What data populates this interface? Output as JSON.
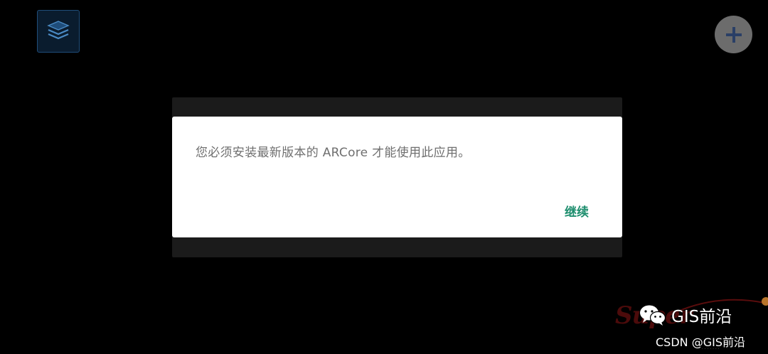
{
  "toolbar": {
    "layers_icon": "layers-icon",
    "add_icon": "plus-icon"
  },
  "dialog": {
    "message": "您必须安装最新版本的 ARCore 才能使用此应用。",
    "continue_label": "继续"
  },
  "watermark": {
    "wechat_icon": "wechat-icon",
    "wechat_account": "GIS前沿",
    "csdn_credit": "CSDN @GIS前沿"
  },
  "colors": {
    "background": "#000000",
    "dialog_background": "#ffffff",
    "message_text": "#6f6f6f",
    "accent_button": "#1e8e6e",
    "fab": "#6c6c6c",
    "layers_border": "#1f4d7a"
  }
}
